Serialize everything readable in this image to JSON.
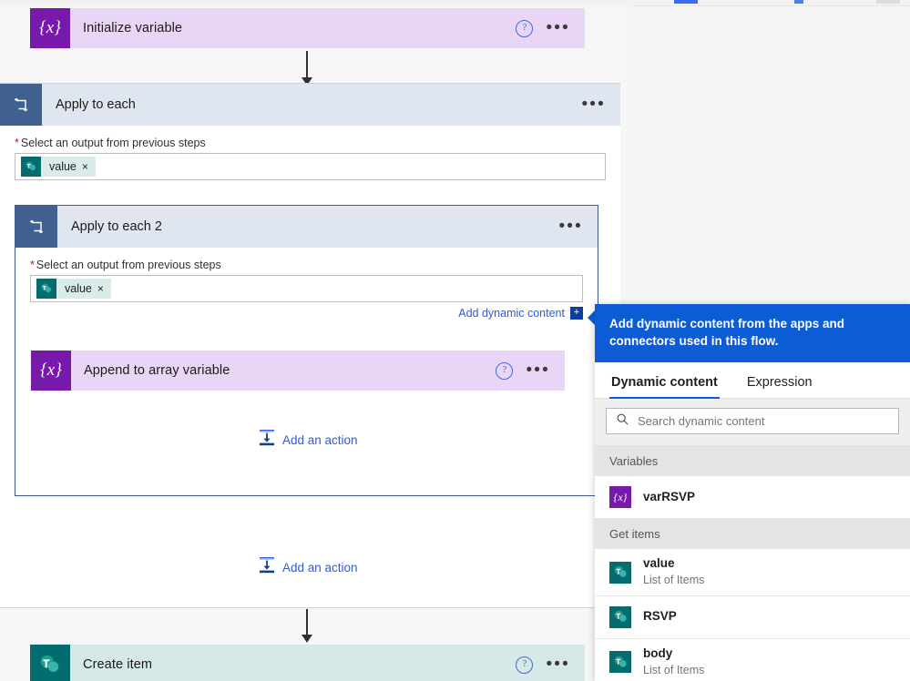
{
  "canvas": {
    "nodes": [
      {
        "id": "initialize-variable",
        "title": "Initialize variable",
        "icon": "variable-icon",
        "type": "variable"
      },
      {
        "id": "apply-to-each",
        "title": "Apply to each",
        "icon": "loop-icon",
        "field_label": "Select an output from previous steps",
        "token": "value",
        "token_icon": "sharepoint-icon",
        "remove_token": "×"
      },
      {
        "id": "apply-to-each-2",
        "title": "Apply to each 2",
        "icon": "loop-icon",
        "field_label": "Select an output from previous steps",
        "token": "value",
        "token_icon": "sharepoint-icon",
        "remove_token": "×",
        "add_dynamic_content": "Add dynamic content",
        "add_dynamic_plus": "+"
      },
      {
        "id": "append-to-array-variable",
        "title": "Append to array variable",
        "icon": "variable-icon",
        "type": "variable"
      },
      {
        "id": "create-item",
        "title": "Create item",
        "icon": "sharepoint-icon",
        "type": "sharepoint"
      }
    ],
    "add_action_inner": "Add an action",
    "add_action_outer": "Add an action",
    "help_glyph": "?",
    "ellipsis_glyph": "•••",
    "variable_glyph": "{x}",
    "required_marker": "*"
  },
  "flyout": {
    "tooltip": "Add dynamic content from the apps and connectors used in this flow.",
    "tabs": [
      {
        "label": "Dynamic content",
        "active": true
      },
      {
        "label": "Expression",
        "active": false
      }
    ],
    "search": {
      "placeholder": "Search dynamic content",
      "value": "",
      "icon": "search-icon"
    },
    "groups": [
      {
        "header": "Variables",
        "items": [
          {
            "name": "varRSVP",
            "sub": "",
            "icon": "variable-icon",
            "kind": "var"
          }
        ]
      },
      {
        "header": "Get items",
        "items": [
          {
            "name": "value",
            "sub": "List of Items",
            "icon": "sharepoint-icon",
            "kind": "sp"
          },
          {
            "name": "RSVP",
            "sub": "",
            "icon": "sharepoint-icon",
            "kind": "sp"
          },
          {
            "name": "body",
            "sub": "List of Items",
            "icon": "sharepoint-icon",
            "kind": "sp"
          }
        ]
      }
    ],
    "variable_glyph": "{x}"
  },
  "colors": {
    "variable_purple": "#7719aa",
    "variable_card_bg": "#e9d6f7",
    "sharepoint_teal": "#036c70",
    "sharepoint_card_bg": "#d5e9e6",
    "scope_header_bg": "#dfe6ef",
    "scope_icon_bg": "#40608f",
    "accent_blue": "#0b5cd5",
    "link_blue": "#2f5bd6",
    "required_red": "#a4262c"
  }
}
